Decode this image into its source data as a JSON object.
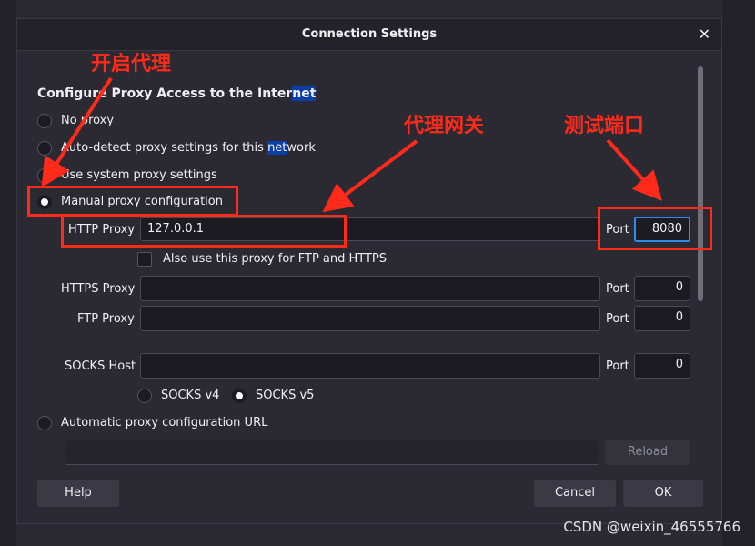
{
  "dialog": {
    "title": "Connection Settings",
    "close_icon": "close-icon"
  },
  "section": {
    "title_a": "Configure Proxy Access to the Inter",
    "title_b": "net"
  },
  "radios": {
    "no_proxy": "No proxy",
    "auto_detect_a": "Auto-detect proxy settings for this ",
    "auto_detect_b": "net",
    "auto_detect_c": "work",
    "system": "Use system proxy settings",
    "manual": "Manual proxy configuration",
    "auto_url": "Automatic proxy configuration URL"
  },
  "http": {
    "label": "HTTP Proxy",
    "value": "127.0.0.1",
    "port_label": "Port",
    "port_value": "8080"
  },
  "also_use": "Also use this proxy for FTP and HTTPS",
  "https": {
    "label": "HTTPS Proxy",
    "value": "",
    "port_label": "Port",
    "port_value": "0"
  },
  "ftp": {
    "label": "FTP Proxy",
    "value": "",
    "port_label": "Port",
    "port_value": "0"
  },
  "socks": {
    "label": "SOCKS Host",
    "value": "",
    "port_label": "Port",
    "port_value": "0",
    "v4": "SOCKS v4",
    "v5": "SOCKS v5"
  },
  "auto_url": {
    "value": "",
    "reload": "Reload"
  },
  "buttons": {
    "help": "Help",
    "cancel": "Cancel",
    "ok": "OK"
  },
  "annotations": {
    "enable_proxy": "开启代理",
    "proxy_gateway": "代理网关",
    "test_port": "测试端口",
    "color": "#ff2a1a"
  },
  "watermark": "CSDN @weixin_46555766"
}
